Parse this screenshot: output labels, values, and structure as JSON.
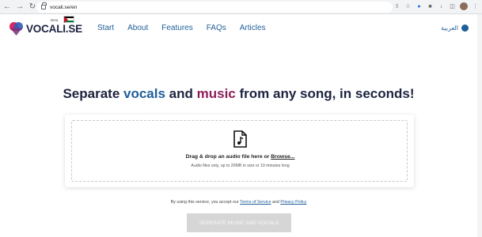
{
  "browser": {
    "url": "vocali.se/en",
    "icons": [
      "back-icon",
      "forward-icon",
      "reload-icon",
      "lock-icon",
      "share-icon",
      "star-icon",
      "extension-icon",
      "puzzle-icon",
      "download-icon",
      "sidebar-icon",
      "profile-avatar",
      "menu-icon"
    ]
  },
  "site": {
    "logo_text": "VOCALI.SE",
    "beta_label": "Beta",
    "nav": {
      "start": "Start",
      "about": "About",
      "features": "Features",
      "faqs": "FAQs",
      "articles": "Articles"
    },
    "language_label": "العربية"
  },
  "hero": {
    "headline_part1": "Separate ",
    "headline_vocals": "vocals",
    "headline_and": " and ",
    "headline_music": "music",
    "headline_rest": " from any song, in seconds!"
  },
  "upload": {
    "drop_text": "Drag & drop an audio file here or ",
    "browse_label": "Browse...",
    "hint": "Audio files only, up to 20MB in size or 10 minutes long"
  },
  "terms": {
    "prefix": "By using this service, you accept our ",
    "terms_link": "Terms of Service",
    "and": " and ",
    "privacy_link": "Privacy Policy"
  },
  "submit_label": "SEPERATE MUSIC AND VOCALS",
  "colors": {
    "accent_blue": "#1f5f99",
    "accent_magenta": "#8e1f5a",
    "dark": "#1d2340"
  }
}
